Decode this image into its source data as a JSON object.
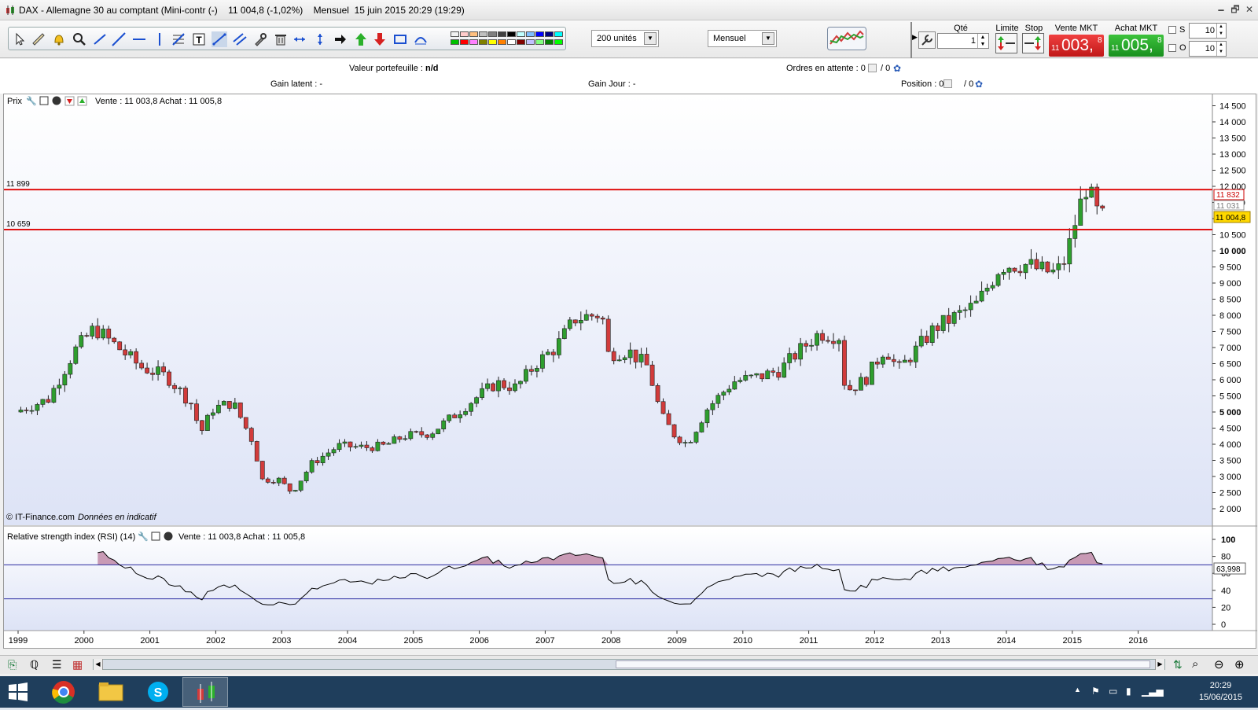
{
  "window": {
    "title": "DAX - Allemagne 30 au comptant (Mini-contr (-)    11 004,8 (-1,02%)    Mensuel  15 juin 2015 20:29 (19:29)",
    "controls": [
      "🗕",
      "🗗",
      "✕"
    ]
  },
  "toolbar": {
    "units_select": "200 unités",
    "period_select": "Mensuel",
    "palette": [
      "#f2f2f2",
      "#ffcccc",
      "#ffc080",
      "#c0c0c0",
      "#808080",
      "#404040",
      "#000000",
      "#c0ffff",
      "#80c0ff",
      "#0000ff",
      "#000080",
      "#00ffff",
      "#00c000",
      "#ff0000",
      "#ff80ff",
      "#808000",
      "#ffff00",
      "#ff8000",
      "#ffffff",
      "#800000",
      "#c0c0ff",
      "#80ff80",
      "#008000",
      "#00ff00"
    ]
  },
  "order_panel": {
    "qty_label": "Qté",
    "qty_value": "1",
    "limit_label": "Limite",
    "stop_label": "Stop",
    "sell_label": "Vente MKT",
    "sell_small": "11",
    "sell_big": "003,",
    "sell_sup": "8",
    "buy_label": "Achat MKT",
    "buy_small": "11",
    "buy_big": "005,",
    "buy_sup": "8",
    "s_label": "S",
    "s_value": "10",
    "o_label": "O",
    "o_value": "10"
  },
  "info": {
    "portfolio_label": "Valeur portefeuille : ",
    "portfolio_value": "n/d",
    "pending_label": "Ordres en attente : 0",
    "pending_slash": "/ 0",
    "unrealized_label": "Gain latent : -",
    "day_gain_label": "Gain Jour : -",
    "position_label": "Position : 0",
    "position_slash": "/ 0"
  },
  "price_panel": {
    "title": "Prix",
    "quote": "Vente : 11 003,8 Achat : 11 005,8",
    "watermark": "© IT-Finance.com",
    "watermark2": "Données en indicatif",
    "line_upper_label": "11 899",
    "line_lower_label": "10 659",
    "tag_red": "11 832",
    "tag_gray": "11 031",
    "tag_yellow": "11 004,8"
  },
  "rsi_panel": {
    "title": "Relative strength index (RSI) (14)",
    "quote": "Vente : 11 003,8 Achat : 11 005,8",
    "value_tag": "63,998"
  },
  "bottom": {
    "time": "20:29",
    "date": "15/06/2015"
  },
  "colors": {
    "up": "#2e9e2e",
    "down": "#d23b3b",
    "hline": "#e01010",
    "chart_bg_top": "#ffffff",
    "chart_bg_bottom": "#dde3f6",
    "rsi_line": "#000000",
    "rsi_fill": "#c08aa8",
    "rsi_band": "#2a2aa0"
  },
  "chart_data": {
    "type": "candlestick",
    "interval": "monthly",
    "y_axis_ticks": [
      "14 500",
      "14 000",
      "13 500",
      "13 000",
      "12 500",
      "12 000",
      "11 500",
      "11 000",
      "10 500",
      "10 000",
      "9 500",
      "9 000",
      "8 500",
      "8 000",
      "7 500",
      "7 000",
      "6 500",
      "6 000",
      "5 500",
      "5 000",
      "4 500",
      "4 000",
      "3 500",
      "3 000",
      "2 500",
      "2 000"
    ],
    "y_bold_ticks": [
      "10 000",
      "5 000"
    ],
    "ylim": [
      2000,
      14500
    ],
    "x_axis_ticks": [
      "1999",
      "2000",
      "2001",
      "2002",
      "2003",
      "2004",
      "2005",
      "2006",
      "2007",
      "2008",
      "2009",
      "2010",
      "2011",
      "2012",
      "2013",
      "2014",
      "2015",
      "2016"
    ],
    "horizontal_lines": [
      11899,
      10659
    ],
    "close_series": [
      [
        1999.0,
        5000
      ],
      [
        1999.5,
        5400
      ],
      [
        1999.9,
        6900
      ],
      [
        2000.2,
        7600
      ],
      [
        2000.5,
        7100
      ],
      [
        2000.9,
        6400
      ],
      [
        2001.3,
        6100
      ],
      [
        2001.7,
        5200
      ],
      [
        2001.8,
        4300
      ],
      [
        2002.0,
        5100
      ],
      [
        2002.3,
        5300
      ],
      [
        2002.6,
        4100
      ],
      [
        2002.75,
        2900
      ],
      [
        2003.0,
        2900
      ],
      [
        2003.2,
        2500
      ],
      [
        2003.5,
        3400
      ],
      [
        2003.9,
        3950
      ],
      [
        2004.3,
        3900
      ],
      [
        2004.6,
        3950
      ],
      [
        2004.9,
        4250
      ],
      [
        2005.3,
        4350
      ],
      [
        2005.6,
        4800
      ],
      [
        2005.9,
        5300
      ],
      [
        2006.3,
        5900
      ],
      [
        2006.6,
        5750
      ],
      [
        2006.9,
        6500
      ],
      [
        2007.2,
        7000
      ],
      [
        2007.5,
        7900
      ],
      [
        2007.9,
        8050
      ],
      [
        2008.0,
        6800
      ],
      [
        2008.3,
        6900
      ],
      [
        2008.6,
        6400
      ],
      [
        2008.8,
        4900
      ],
      [
        2009.0,
        4300
      ],
      [
        2009.2,
        4000
      ],
      [
        2009.5,
        5100
      ],
      [
        2009.9,
        5950
      ],
      [
        2010.3,
        6100
      ],
      [
        2010.6,
        6300
      ],
      [
        2010.9,
        6900
      ],
      [
        2011.2,
        7450
      ],
      [
        2011.5,
        7350
      ],
      [
        2011.6,
        5650
      ],
      [
        2011.9,
        6000
      ],
      [
        2012.2,
        7000
      ],
      [
        2012.4,
        6300
      ],
      [
        2012.7,
        7000
      ],
      [
        2012.95,
        7600
      ],
      [
        2013.3,
        8000
      ],
      [
        2013.6,
        8350
      ],
      [
        2013.95,
        9550
      ],
      [
        2014.3,
        9600
      ],
      [
        2014.55,
        9400
      ],
      [
        2014.8,
        9300
      ],
      [
        2014.95,
        9800
      ],
      [
        2015.1,
        11000
      ],
      [
        2015.25,
        12000
      ],
      [
        2015.35,
        11500
      ],
      [
        2015.45,
        11000
      ]
    ]
  }
}
